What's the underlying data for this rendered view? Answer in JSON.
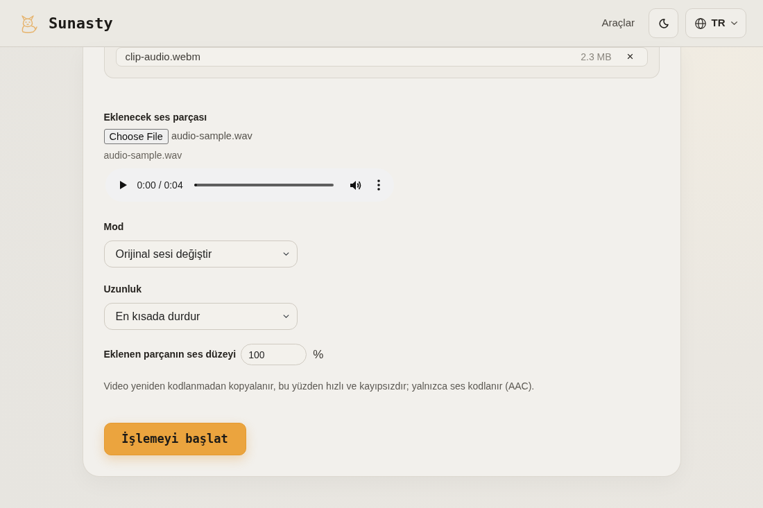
{
  "header": {
    "brand": "Sunasty",
    "nav_link": "Araçlar",
    "language": "TR"
  },
  "attached_file": {
    "name": "clip-audio.webm",
    "size": "2.3 MB",
    "remove": "×"
  },
  "audio_track": {
    "label": "Eklenecek ses parçası",
    "button": "Choose File",
    "file_name": "audio-sample.wav",
    "caption": "audio-sample.wav",
    "player": {
      "time": "0:00 / 0:04",
      "level": 0
    }
  },
  "mode": {
    "label": "Mod",
    "value": "Orijinal sesi değiştir"
  },
  "length": {
    "label": "Uzunluk",
    "value": "En kısada durdur"
  },
  "volume": {
    "label": "Eklenen parçanın ses düzeyi",
    "value": "100",
    "unit": "%"
  },
  "note": "Video yeniden kodlanmadan kopyalanır, bu yüzden hızlı ve kayıpsızdır; yalnızca ses kodlanır (AAC).",
  "submit": "İşlemeyi başlat"
}
